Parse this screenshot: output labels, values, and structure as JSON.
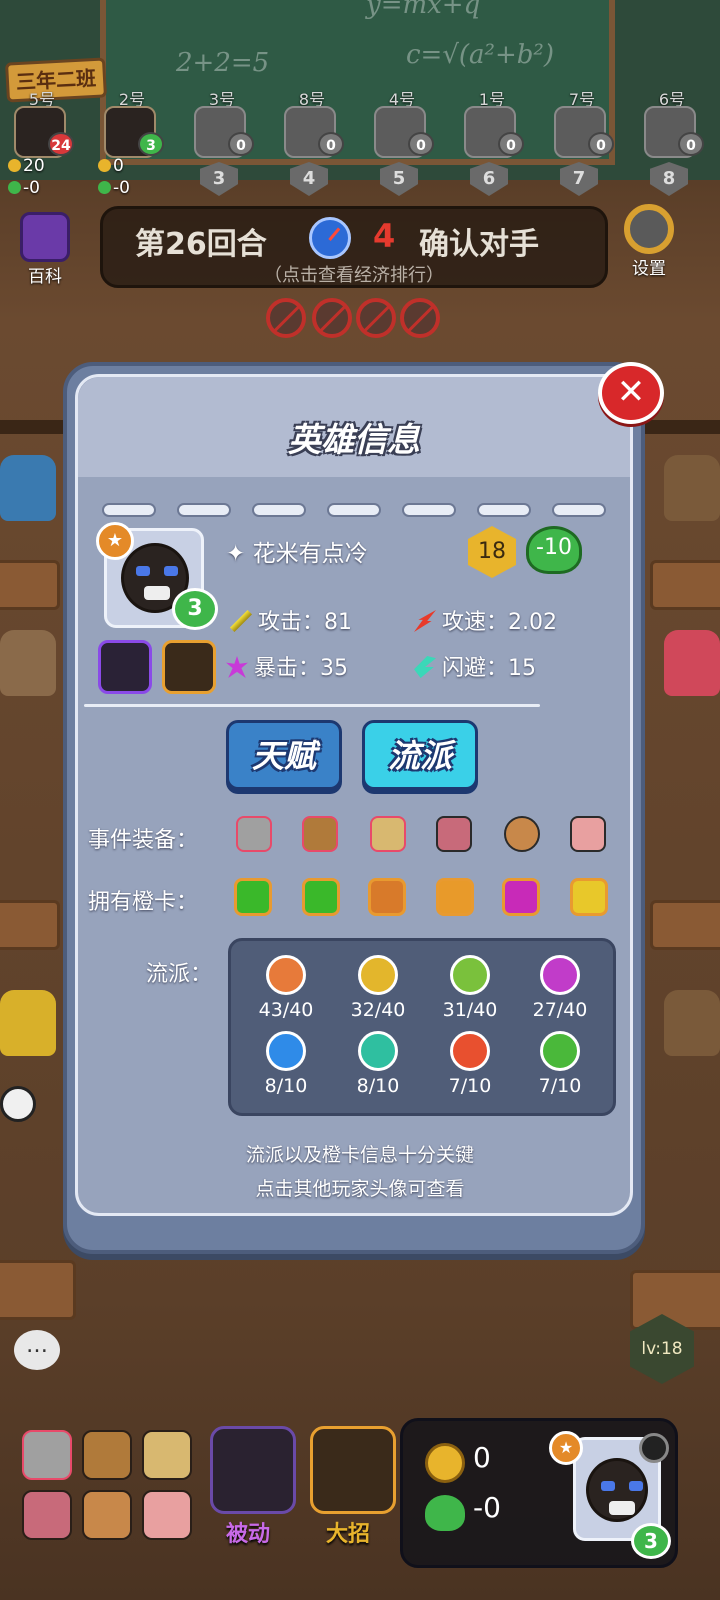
{
  "players": [
    {
      "seat": "5号",
      "hp_badge": "24",
      "hp_color": "red",
      "rank": "",
      "gold": "20",
      "hp_change": "-0",
      "active": true
    },
    {
      "seat": "2号",
      "hp_badge": "3",
      "hp_color": "green",
      "rank": "",
      "gold": "0",
      "hp_change": "-0",
      "active": true
    },
    {
      "seat": "3号",
      "hp_badge": "0",
      "hp_color": "grey",
      "rank": "3"
    },
    {
      "seat": "8号",
      "hp_badge": "0",
      "hp_color": "grey",
      "rank": "4"
    },
    {
      "seat": "4号",
      "hp_badge": "0",
      "hp_color": "grey",
      "rank": "5"
    },
    {
      "seat": "1号",
      "hp_badge": "0",
      "hp_color": "grey",
      "rank": "6"
    },
    {
      "seat": "7号",
      "hp_badge": "0",
      "hp_color": "grey",
      "rank": "7"
    },
    {
      "seat": "6号",
      "hp_badge": "0",
      "hp_color": "grey",
      "rank": "8"
    }
  ],
  "classroom_sign": "三年二班",
  "top_bar": {
    "encyclopedia_label": "百科",
    "settings_label": "设置",
    "round_title": "第26回合",
    "timer_value": "4",
    "confirm_label": "确认对手",
    "economy_hint": "（点击查看经济排行）"
  },
  "modal": {
    "title": "英雄信息",
    "hero_name": "花米有点冷",
    "hero_stars": "3",
    "gold_value": "18",
    "hp_value": "-10",
    "stats": {
      "attack_label": "攻击：81",
      "attack_speed_label": "攻速：2.02",
      "crit_label": "暴击：35",
      "dodge_label": "闪避：15"
    },
    "tabs": {
      "talent": "天赋",
      "faction": "流派"
    },
    "event_equipment_label": "事件装备：",
    "orange_cards_label": "拥有橙卡：",
    "faction_label": "流派：",
    "factions": [
      {
        "value": "43/40",
        "icon": "shield-icon",
        "color": "#e77a3a"
      },
      {
        "value": "32/40",
        "icon": "sword-icon",
        "color": "#e3b62c"
      },
      {
        "value": "31/40",
        "icon": "plus-icon",
        "color": "#7ac13c"
      },
      {
        "value": "27/40",
        "icon": "burst-icon",
        "color": "#c13cc9"
      },
      {
        "value": "8/10",
        "icon": "snowflake-icon",
        "color": "#2f8be8"
      },
      {
        "value": "8/10",
        "icon": "wing-icon",
        "color": "#2fbfa0"
      },
      {
        "value": "7/10",
        "icon": "flame-icon",
        "color": "#e8502f"
      },
      {
        "value": "7/10",
        "icon": "paw-icon",
        "color": "#4ab83a"
      }
    ],
    "hint_line1": "流派以及橙卡信息十分关键",
    "hint_line2": "点击其他玩家头像可查看"
  },
  "bottom": {
    "passive_label": "被动",
    "ultimate_label": "大招",
    "gold": "0",
    "hp_change": "-0",
    "self_stars": "3",
    "level_label": "lv:18"
  },
  "colors": {
    "modal_bg": "#97a3bc",
    "accent_red": "#d8282a",
    "heart_green": "#3fb64a",
    "gold": "#e8b42c"
  }
}
